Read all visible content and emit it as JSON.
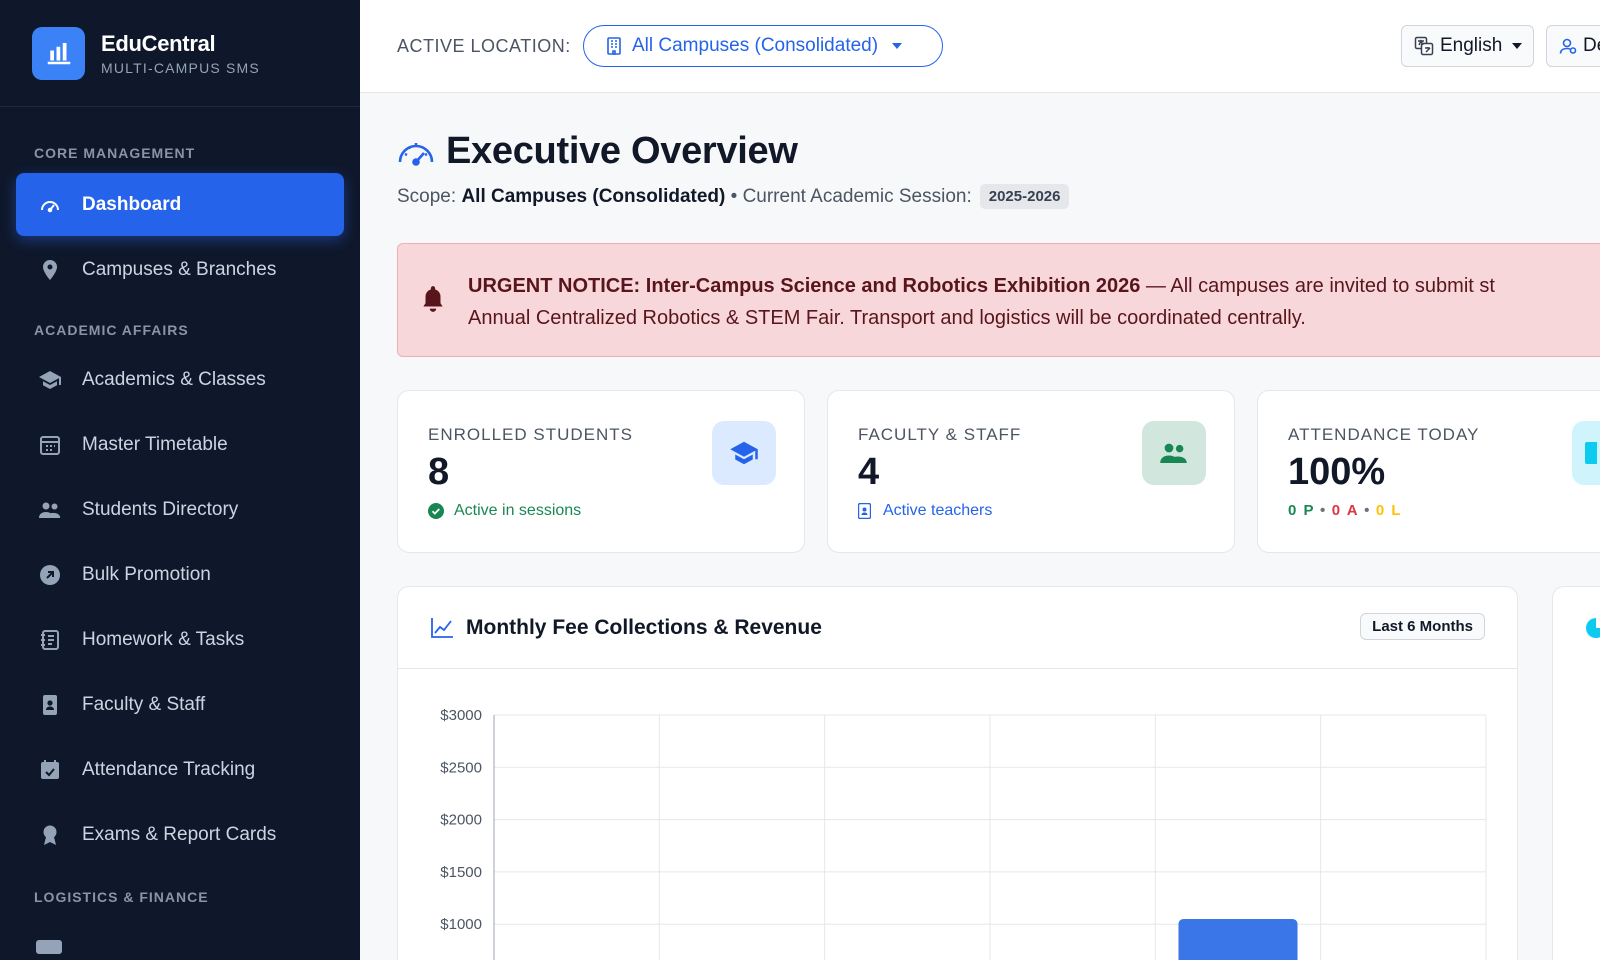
{
  "brand": {
    "name": "EduCentral",
    "subtitle": "MULTI-CAMPUS SMS"
  },
  "sidebar": {
    "sections": [
      "CORE MANAGEMENT",
      "ACADEMIC AFFAIRS",
      "LOGISTICS & FINANCE"
    ],
    "items": [
      {
        "label": "Dashboard",
        "icon": "speedometer-icon",
        "active": true
      },
      {
        "label": "Campuses & Branches",
        "icon": "map-pin-icon"
      },
      {
        "label": "Academics & Classes",
        "icon": "graduation-cap-icon"
      },
      {
        "label": "Master Timetable",
        "icon": "calendar-grid-icon"
      },
      {
        "label": "Students Directory",
        "icon": "people-icon"
      },
      {
        "label": "Bulk Promotion",
        "icon": "arrow-up-right-circle-icon"
      },
      {
        "label": "Homework & Tasks",
        "icon": "journal-icon"
      },
      {
        "label": "Faculty & Staff",
        "icon": "id-badge-icon"
      },
      {
        "label": "Attendance Tracking",
        "icon": "calendar-check-icon"
      },
      {
        "label": "Exams & Report Cards",
        "icon": "award-icon"
      }
    ]
  },
  "header": {
    "location_label": "ACTIVE LOCATION:",
    "location_value": "All Campuses (Consolidated)",
    "language": "English",
    "user_label": "De"
  },
  "page": {
    "title": "Executive Overview",
    "scope_label": "Scope:",
    "scope_value": "All Campuses (Consolidated)",
    "session_label": "• Current Academic Session:",
    "session_value": "2025-2026"
  },
  "notice": {
    "title": "URGENT NOTICE: Inter-Campus Science and Robotics Exhibition 2026",
    "line1": "— All campuses are invited to submit st",
    "line2": "Annual Centralized Robotics & STEM Fair. Transport and logistics will be coordinated centrally."
  },
  "stats": [
    {
      "label": "ENROLLED STUDENTS",
      "value": "8",
      "sub": "Active in sessions",
      "sub_color": "#198754",
      "icon": "graduation-cap-icon"
    },
    {
      "label": "FACULTY & STAFF",
      "value": "4",
      "sub": "Active teachers",
      "sub_color": "#2563eb",
      "icon": "people-icon"
    },
    {
      "label": "ATTENDANCE TODAY",
      "value": "100%",
      "breakdown": [
        "0 P",
        "0 A",
        "0 L"
      ],
      "icon": "clipboard-icon"
    }
  ],
  "chart": {
    "title": "Monthly Fee Collections & Revenue",
    "range": "Last 6 Months"
  },
  "chart_data": {
    "type": "bar",
    "title": "Monthly Fee Collections & Revenue",
    "categories": [
      "",
      "",
      "",
      "",
      "",
      ""
    ],
    "values": [
      0,
      0,
      0,
      0,
      1050,
      0
    ],
    "yticks": [
      "$3000",
      "$2500",
      "$2000",
      "$1500",
      "$1000"
    ],
    "ylim": [
      0,
      3000
    ],
    "grid": true,
    "color": "#3b76e8"
  },
  "colors": {
    "accent": "#2563eb",
    "sidebar": "#0f172a",
    "present": "#198754",
    "absent": "#dc3545",
    "late": "#ffc107"
  }
}
